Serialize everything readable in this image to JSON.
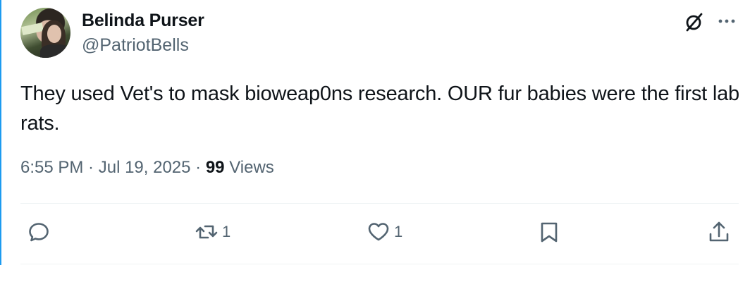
{
  "author": {
    "name": "Belinda Purser",
    "handle": "@PatriotBells"
  },
  "tweet": {
    "text": "They used Vet's to mask bioweap0ns research. OUR fur babies were the first lab rats."
  },
  "meta": {
    "time": "6:55 PM",
    "separator": " · ",
    "date": "Jul 19, 2025",
    "views_count": "99",
    "views_label": "Views"
  },
  "actions": {
    "reply": {
      "icon": "reply-icon",
      "count": ""
    },
    "repost": {
      "icon": "repost-icon",
      "count": "1"
    },
    "like": {
      "icon": "heart-icon",
      "count": "1"
    },
    "bookmark": {
      "icon": "bookmark-icon"
    },
    "share": {
      "icon": "share-icon"
    }
  },
  "header_icons": [
    "grok-icon",
    "more-icon"
  ],
  "colors": {
    "text": "#0f1419",
    "secondary": "#536471",
    "divider": "#eff3f4",
    "accent": "#1d9bf0"
  }
}
